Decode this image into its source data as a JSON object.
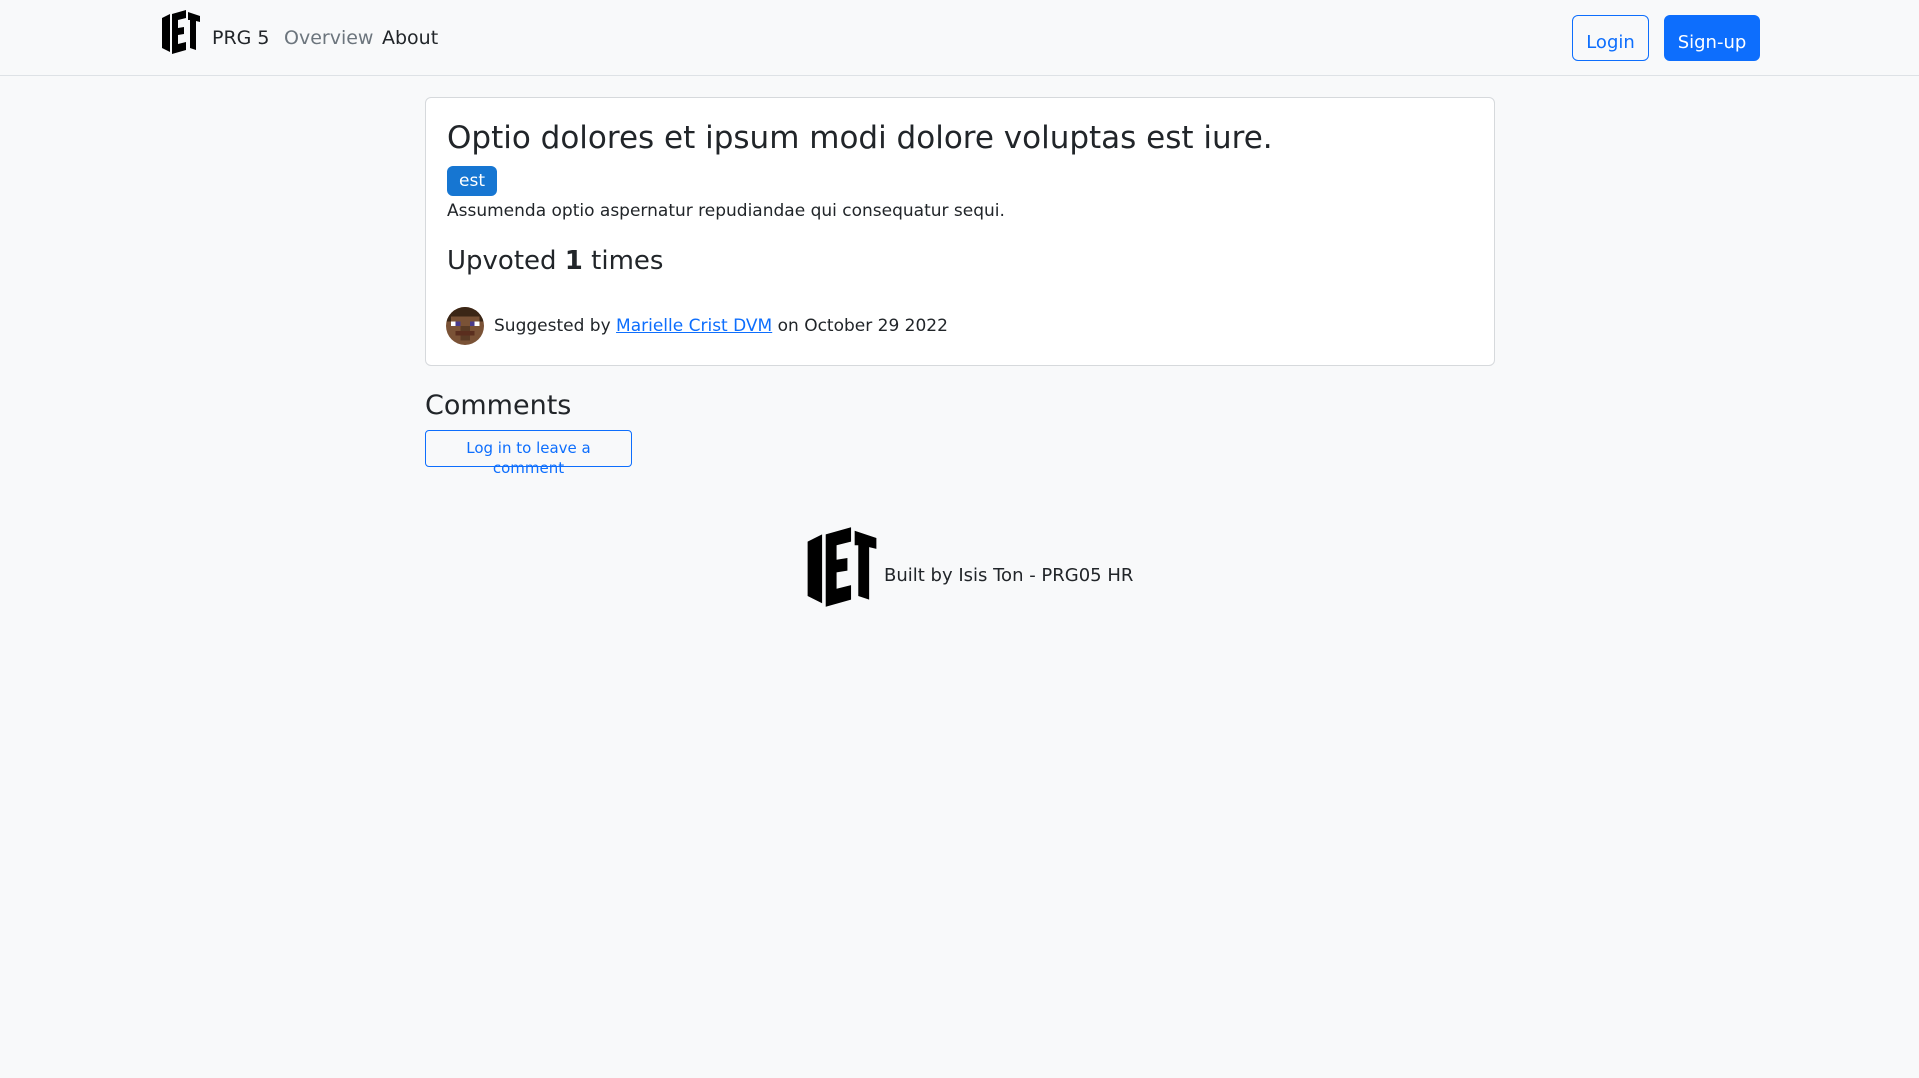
{
  "navbar": {
    "brand": "PRG 5",
    "links": [
      "Overview",
      "About"
    ],
    "login_label": "Login",
    "signup_label": "Sign-up"
  },
  "post": {
    "title": "Optio dolores et ipsum modi dolore voluptas est iure.",
    "tag": "est",
    "description": "Assumenda optio aspernatur repudiandae qui consequatur sequi.",
    "upvote_prefix": "Upvoted",
    "upvote_count": "1",
    "upvote_suffix": "times",
    "suggested_prefix": "Suggested by",
    "author": "Marielle Crist DVM",
    "date_text": "on October 29 2022"
  },
  "comments": {
    "heading": "Comments",
    "login_button": "Log in to leave a comment"
  },
  "footer": {
    "text": "Built by Isis Ton - PRG05 HR"
  },
  "colors": {
    "primary": "#0d6efd",
    "badge": "#1676d2",
    "background": "#f8f9fa"
  },
  "icons": {
    "brand_logo": "cmgt-logo",
    "avatar": "pixel-avatar-icon",
    "footer_logo": "cmgt-logo"
  }
}
